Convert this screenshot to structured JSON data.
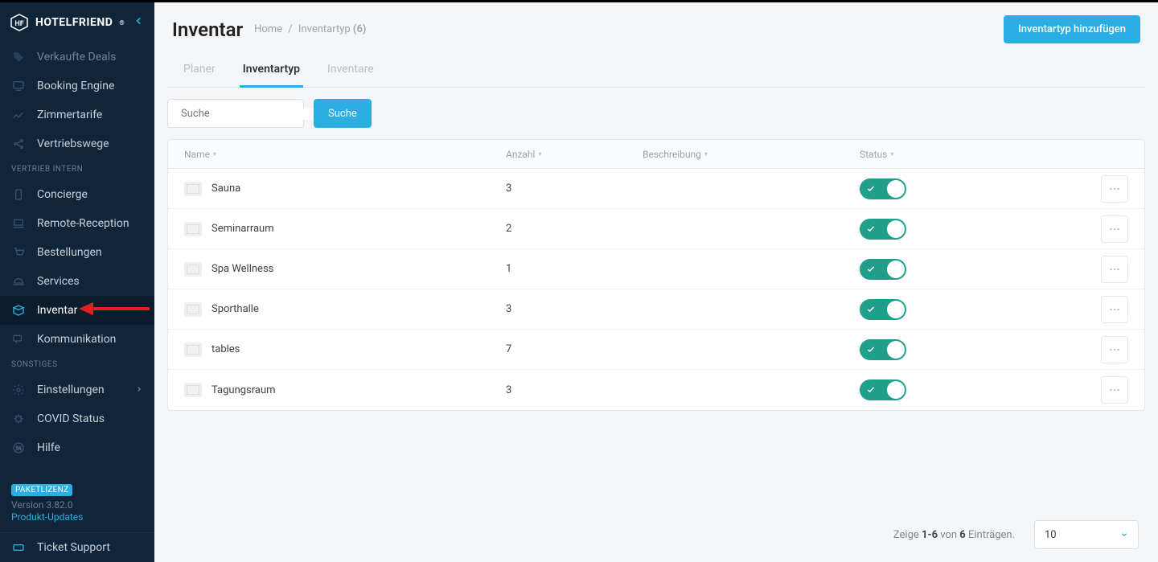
{
  "brand": {
    "name": "HOTELFRIEND",
    "reg": "®"
  },
  "sidebar": {
    "section1_label": "VERTRIEB INTERN",
    "section2_label": "SONSTIGES",
    "items_top": [
      {
        "label": "Verkaufte Deals",
        "icon": "tag-icon"
      },
      {
        "label": "Booking Engine",
        "icon": "monitor-icon"
      },
      {
        "label": "Zimmertarife",
        "icon": "chart-icon"
      },
      {
        "label": "Vertriebswege",
        "icon": "nodes-icon"
      }
    ],
    "items_mid": [
      {
        "label": "Concierge",
        "icon": "phone-icon"
      },
      {
        "label": "Remote-Reception",
        "icon": "desk-icon"
      },
      {
        "label": "Bestellungen",
        "icon": "cart-icon"
      },
      {
        "label": "Services",
        "icon": "dish-icon"
      },
      {
        "label": "Inventar",
        "icon": "box-icon",
        "active": true
      },
      {
        "label": "Kommunikation",
        "icon": "chat-icon"
      }
    ],
    "items_bot": [
      {
        "label": "Einstellungen",
        "icon": "gear-icon",
        "chevron": true
      },
      {
        "label": "COVID Status",
        "icon": "virus-icon"
      },
      {
        "label": "Hilfe",
        "icon": "help-icon"
      }
    ],
    "license": "PAKETLIZENZ",
    "version": "Version 3.82.0",
    "updates_link": "Produkt-Updates",
    "ticket": "Ticket Support"
  },
  "header": {
    "title": "Inventar",
    "crumb_home": "Home",
    "crumb_current": "Inventartyp",
    "crumb_count": "(6)",
    "add_btn": "Inventartyp hinzufügen"
  },
  "tabs": [
    {
      "label": "Planer"
    },
    {
      "label": "Inventartyp",
      "active": true
    },
    {
      "label": "Inventare"
    }
  ],
  "toolbar": {
    "search_placeholder": "Suche",
    "search_btn": "Suche"
  },
  "table": {
    "columns": {
      "name": "Name",
      "count": "Anzahl",
      "desc": "Beschreibung",
      "status": "Status"
    },
    "rows": [
      {
        "name": "Sauna",
        "count": "3",
        "status": true
      },
      {
        "name": "Seminarraum",
        "count": "2",
        "status": true
      },
      {
        "name": "Spa Wellness",
        "count": "1",
        "status": true
      },
      {
        "name": "Sporthalle",
        "count": "3",
        "status": true
      },
      {
        "name": "tables",
        "count": "7",
        "status": true
      },
      {
        "name": "Tagungsraum",
        "count": "3",
        "status": true
      }
    ]
  },
  "pager": {
    "text_pre": "Zeige ",
    "range": "1-6",
    "text_mid": " von ",
    "total": "6",
    "text_post": " Einträgen.",
    "page_size": "10"
  }
}
